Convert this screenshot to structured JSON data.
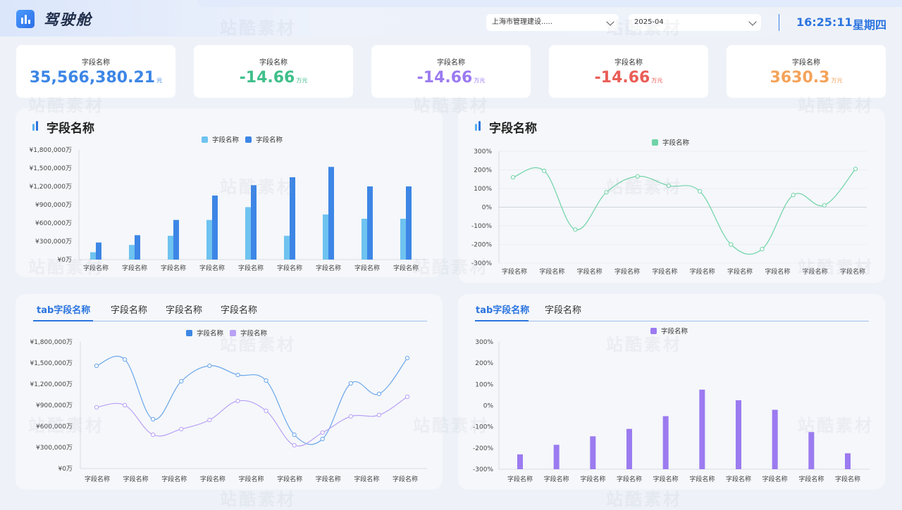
{
  "header": {
    "app_title": "驾驶舱",
    "region_select": "上海市管理建设.....",
    "month_select": "2025-04",
    "time": "16:25:11",
    "weekday": "星期四"
  },
  "kpis": [
    {
      "label": "字段名称",
      "value": "35,566,380.21",
      "unit": "元",
      "color": "#3d86e6"
    },
    {
      "label": "字段名称",
      "value": "-14.66",
      "unit": "万元",
      "color": "#3fbf8a"
    },
    {
      "label": "字段名称",
      "value": "-14.66",
      "unit": "万元",
      "color": "#9b7bf0"
    },
    {
      "label": "字段名称",
      "value": "-14.66",
      "unit": "万元",
      "color": "#ea5d57"
    },
    {
      "label": "字段名称",
      "value": "3630.3",
      "unit": "万元",
      "color": "#f4a35a"
    }
  ],
  "panel1": {
    "title": "字段名称"
  },
  "panel2": {
    "title": "字段名称"
  },
  "panel3": {
    "tabs": [
      "tab字段名称",
      "字段名称",
      "字段名称",
      "字段名称"
    ]
  },
  "panel4": {
    "tabs": [
      "tab字段名称",
      "字段名称"
    ]
  },
  "colors": {
    "accent": "#2b74e0",
    "light_blue": "#6ec3f0",
    "blue": "#3d86e6",
    "green": "#6fd3a7",
    "purple": "#9b7bf0"
  },
  "chart_data": [
    {
      "type": "bar",
      "categories": [
        "字段名称",
        "字段名称",
        "字段名称",
        "字段名称",
        "字段名称",
        "字段名称",
        "字段名称",
        "字段名称",
        "字段名称"
      ],
      "series": [
        {
          "name": "字段名称",
          "values": [
            120000,
            240000,
            390000,
            650000,
            860000,
            390000,
            740000,
            670000,
            670000
          ]
        },
        {
          "name": "字段名称",
          "values": [
            280000,
            400000,
            650000,
            1050000,
            1220000,
            1350000,
            1520000,
            1200000,
            1200000
          ]
        }
      ],
      "y_ticks": [
        "¥0万",
        "¥300,000万",
        "¥600,000万",
        "¥900,000万",
        "¥1,200,000万",
        "¥1,500,000万",
        "¥1,800,000万"
      ],
      "ylim": [
        0,
        1800000
      ]
    },
    {
      "type": "line",
      "categories": [
        "字段名称",
        "字段名称",
        "字段名称",
        "字段名称",
        "字段名称",
        "字段名称",
        "字段名称",
        "字段名称",
        "字段名称",
        "字段名称"
      ],
      "series": [
        {
          "name": "字段名称",
          "values": [
            160,
            195,
            -120,
            80,
            165,
            115,
            85,
            -200,
            -225,
            65,
            10,
            205
          ]
        }
      ],
      "y_ticks": [
        "-300%",
        "-200%",
        "-100%",
        "0%",
        "100%",
        "200%",
        "300%"
      ],
      "ylim": [
        -300,
        300
      ]
    },
    {
      "type": "line",
      "categories": [
        "字段名称",
        "字段名称",
        "字段名称",
        "字段名称",
        "字段名称",
        "字段名称",
        "字段名称",
        "字段名称",
        "字段名称"
      ],
      "series": [
        {
          "name": "字段名称",
          "values": [
            1460000,
            1550000,
            700000,
            1240000,
            1460000,
            1330000,
            1250000,
            480000,
            420000,
            1210000,
            1060000,
            1570000
          ]
        },
        {
          "name": "字段名称",
          "values": [
            870000,
            900000,
            480000,
            560000,
            690000,
            960000,
            820000,
            330000,
            510000,
            740000,
            760000,
            1020000
          ]
        }
      ],
      "y_ticks": [
        "¥0万",
        "¥300,000万",
        "¥600,000万",
        "¥900,000万",
        "¥1,200,000万",
        "¥1,500,000万",
        "¥1,800,000万"
      ],
      "ylim": [
        0,
        1800000
      ]
    },
    {
      "type": "bar",
      "categories": [
        "字段名称",
        "字段名称",
        "字段名称",
        "字段名称",
        "字段名称",
        "字段名称",
        "字段名称",
        "字段名称",
        "字段名称",
        "字段名称"
      ],
      "series": [
        {
          "name": "字段名称",
          "values": [
            -230,
            -185,
            -145,
            -110,
            -50,
            75,
            25,
            -20,
            -125,
            -225
          ]
        }
      ],
      "y_ticks": [
        "-300%",
        "-200%",
        "-100%",
        "0%",
        "100%",
        "200%",
        "300%"
      ],
      "ylim": [
        -300,
        300
      ]
    }
  ]
}
